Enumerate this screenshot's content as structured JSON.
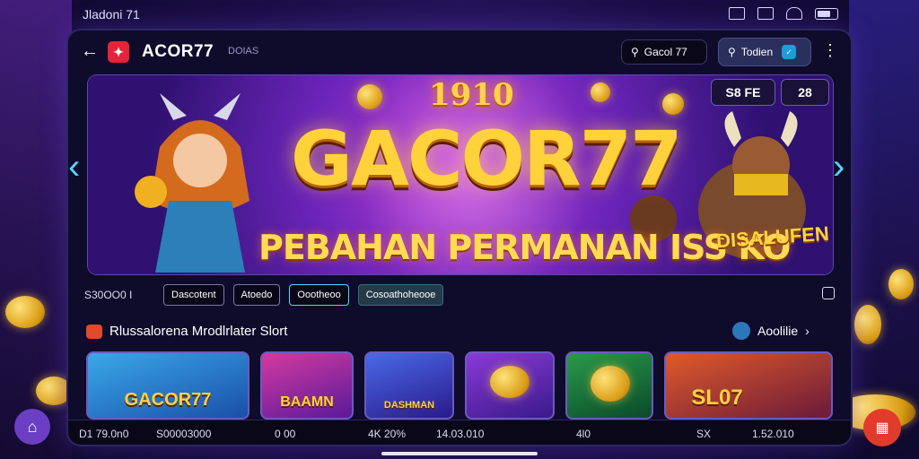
{
  "status_bar": {
    "time": "Jladoni 71"
  },
  "app_bar": {
    "title": "ACOR77",
    "subtitle": "DOIAS",
    "search_label": "Gacol 77",
    "login_label": "Todien"
  },
  "banner": {
    "top_number": "1910",
    "title": "GACOR77",
    "subtitle": "PEBAHAN PERMANAN ISS KO",
    "tag": "DISALUFEN",
    "badge_1": "S8 FE",
    "badge_2": "28"
  },
  "filters": {
    "label": "S30OO0 I",
    "chips": [
      "Dascotent",
      "Atoedo",
      "Oootheoo",
      "Cosoathoheooe"
    ]
  },
  "section": {
    "title": "Rlussalorena Mrodlrlater Slort",
    "more_label": "Aoolilie"
  },
  "cards": [
    {
      "label": "GACOR77"
    },
    {
      "label": "BAAMN"
    },
    {
      "label": "DASHMAN"
    },
    {
      "label": ""
    },
    {
      "label": ""
    },
    {
      "label": "SL07"
    }
  ],
  "footer": {
    "items": [
      "D1 79.0n0",
      "S00003000",
      "0 00",
      "4K 20%",
      "14.03.010",
      "4l0",
      "SX",
      "1.52.010"
    ]
  },
  "colors": {
    "accent": "#ffd23c",
    "brand": "#e3243b",
    "background": "#1c0f4a"
  }
}
